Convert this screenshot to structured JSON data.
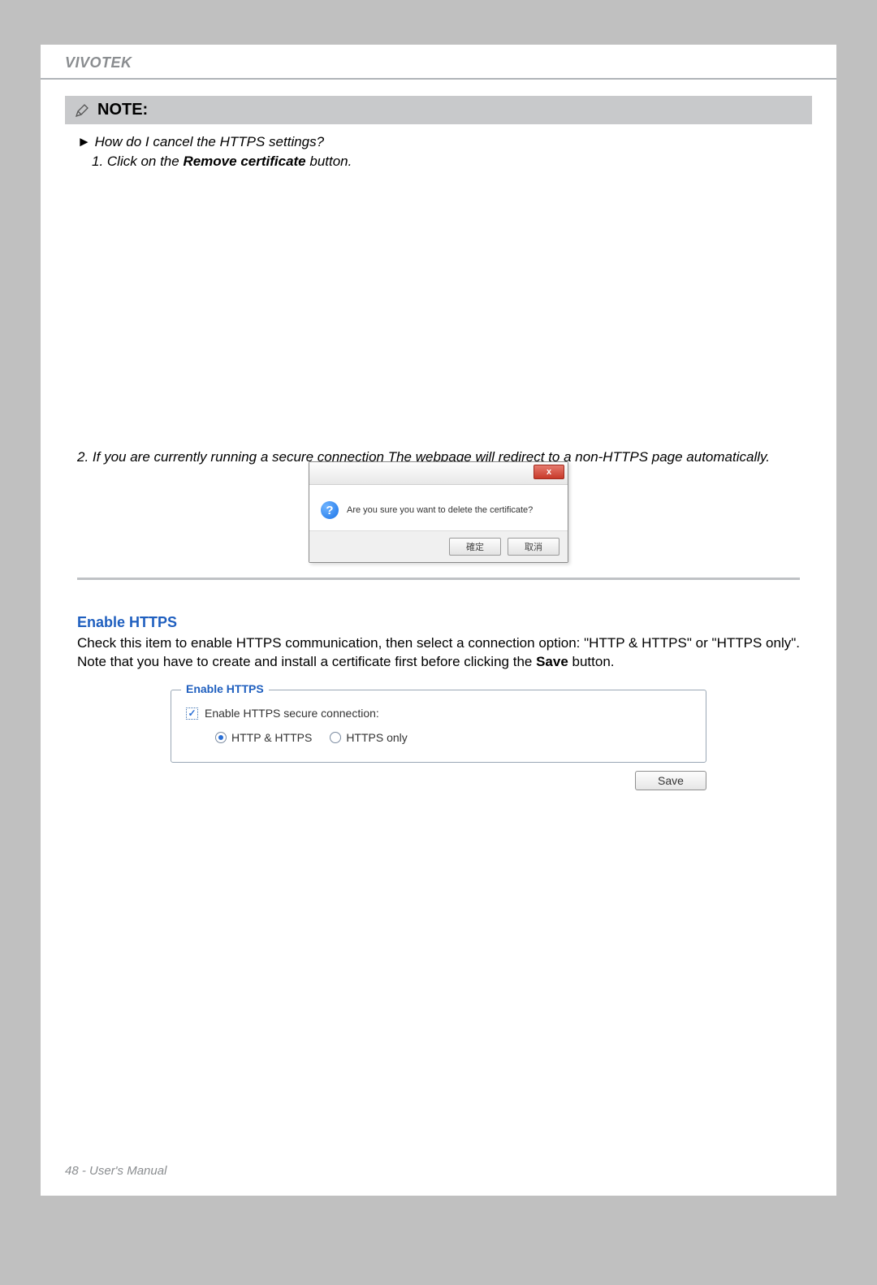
{
  "header": {
    "brand": "VIVOTEK"
  },
  "note": {
    "title": "NOTE:",
    "q_arrow": "►",
    "q_text": "How do I cancel the HTTPS settings?",
    "step1_prefix": "1. Click on the ",
    "step1_bold": "Remove certificate",
    "step1_suffix": " button.",
    "step2": "2. If you are currently running a secure connection The webpage will redirect to a non-HTTPS page automatically."
  },
  "dialog": {
    "close": "x",
    "q_mark": "?",
    "message": "Are you sure you want to delete the certificate?",
    "ok": "確定",
    "cancel": "取消"
  },
  "section": {
    "title": "Enable HTTPS",
    "text_prefix": "Check this item to enable HTTPS communication, then select a connection option: \"HTTP & HTTPS\" or \"HTTPS only\". Note that you have to create and install a certificate first before clicking the ",
    "text_bold": "Save",
    "text_suffix": " button."
  },
  "fieldset": {
    "legend": "Enable HTTPS",
    "checkbox_label": "Enable HTTPS secure connection:",
    "checkbox_checked": "✓",
    "option1": "HTTP & HTTPS",
    "option2": "HTTPS only"
  },
  "save_button": "Save",
  "footer": "48 - User's Manual"
}
